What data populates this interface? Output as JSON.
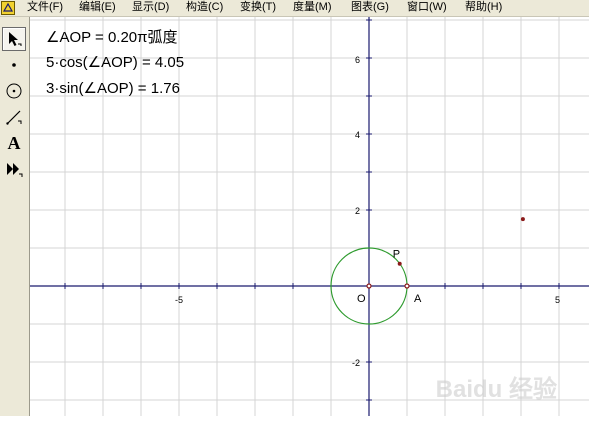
{
  "menu": {
    "items": [
      {
        "label": "文件(F)"
      },
      {
        "label": "编辑(E)"
      },
      {
        "label": "显示(D)"
      },
      {
        "label": "构造(C)"
      },
      {
        "label": "变换(T)"
      },
      {
        "label": "度量(M)"
      },
      {
        "label": "图表(G)"
      },
      {
        "label": "窗口(W)"
      },
      {
        "label": "帮助(H)"
      }
    ]
  },
  "toolbar": {
    "tools": [
      {
        "icon": "arrow-select-icon",
        "active": true
      },
      {
        "icon": "point-icon"
      },
      {
        "icon": "compass-icon"
      },
      {
        "icon": "straightedge-icon"
      },
      {
        "icon": "text-tool-icon",
        "label": "A"
      },
      {
        "icon": "custom-tool-icon"
      }
    ]
  },
  "measurements": {
    "angle": "∠AOP = 0.20π弧度",
    "cos": "5·cos(∠AOP) = 4.05",
    "sin": "3·sin(∠AOP) = 1.76"
  },
  "graph": {
    "x_ticks": [
      "-5",
      "5"
    ],
    "y_ticks": [
      "6",
      "4",
      "2",
      "-2"
    ],
    "origin_label": "O",
    "point_p_label": "P",
    "point_a_label": "A",
    "plotted_point": {
      "x": 4.05,
      "y": 1.76
    },
    "circle_radius": 1,
    "angle_fraction_of_pi": 0.2,
    "axis_color": "#1a1a6e",
    "circle_color": "#2e9b2e",
    "point_color": "#8b1a1a",
    "grid_color": "#d4d4d4"
  },
  "watermark": "Baidu 经验"
}
